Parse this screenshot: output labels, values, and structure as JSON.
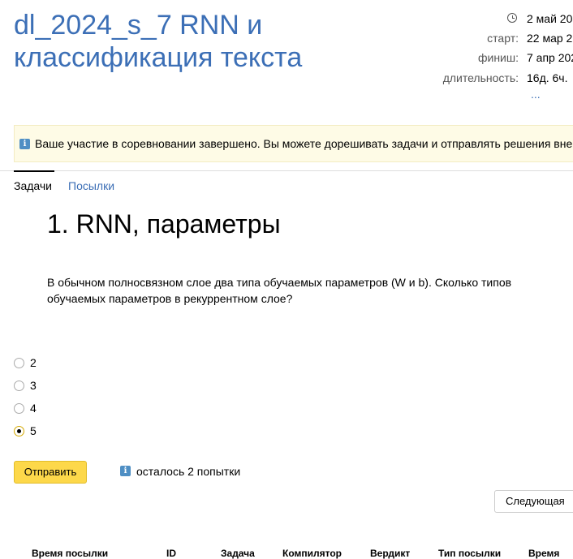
{
  "header": {
    "title_line1": "dl_2024_s_7 RNN и",
    "title_line2": "классификация текста",
    "current_time": "2 май 20",
    "start_label": "старт:",
    "start_value": "22 мар 2",
    "finish_label": "финиш:",
    "finish_value": "7 апр 202",
    "duration_label": "длительность:",
    "duration_value": "16д. 6ч.",
    "more": "..."
  },
  "notice": {
    "icon": "info-icon",
    "text": "Ваше участие в соревновании завершено. Вы можете дорешивать задачи и отправлять решения вне"
  },
  "tabs": [
    {
      "label": "Задачи",
      "active": true
    },
    {
      "label": "Посылки",
      "active": false
    }
  ],
  "problem": {
    "title": "1. RNN, параметры",
    "text": "В обычном полносвязном слое два типа обучаемых параметров (W и b). Сколько типов обучаемых параметров в рекуррентном слое?",
    "options": [
      {
        "label": "2",
        "checked": false
      },
      {
        "label": "3",
        "checked": false
      },
      {
        "label": "4",
        "checked": false
      },
      {
        "label": "5",
        "checked": true
      }
    ]
  },
  "actions": {
    "submit_label": "Отправить",
    "attempts_text": "осталось 2 попытки",
    "next_label": "Следующая"
  },
  "table": {
    "headers": [
      "Время посылки",
      "ID",
      "Задача",
      "Компилятор",
      "Вердикт",
      "Тип посылки",
      "Время"
    ]
  },
  "colors": {
    "link": "#3c6fb6",
    "submit_button": "#fdd84a",
    "notice_background": "#fefbe6",
    "info_icon": "#4f8fc4"
  }
}
